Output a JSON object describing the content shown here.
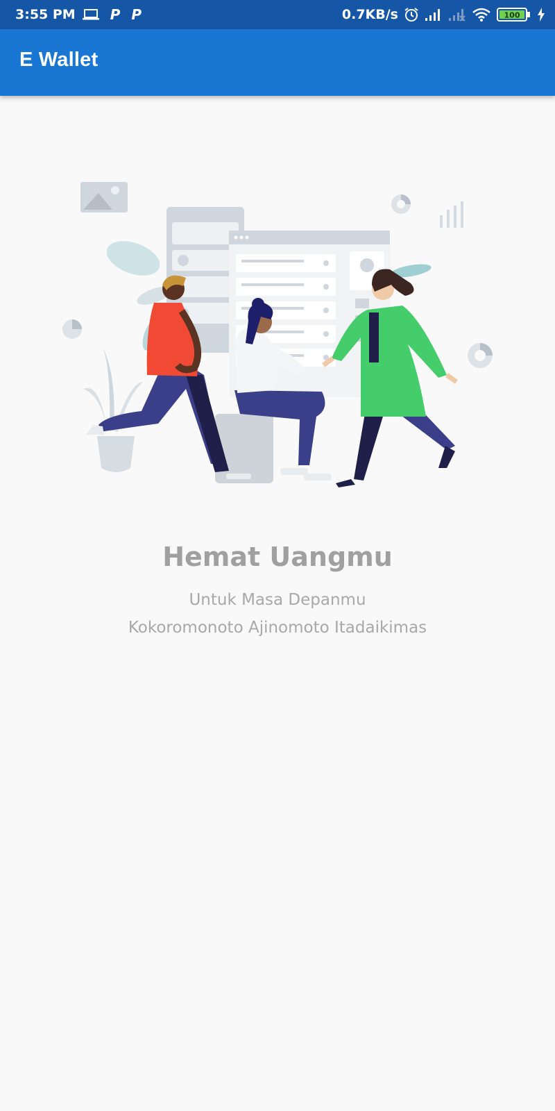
{
  "status_bar": {
    "time": "3:55 PM",
    "net_speed": "0.7KB/s",
    "battery": "100",
    "icons": [
      "laptop-icon",
      "parking-p-icon",
      "parking-p-icon",
      "alarm-icon",
      "signal-icon",
      "signal-no-service-icon",
      "wifi-icon",
      "battery-icon",
      "charging-bolt-icon"
    ]
  },
  "app_bar": {
    "title": "E Wallet"
  },
  "onboarding": {
    "illustration": "people-collaborating-illustration",
    "headline": "Hemat Uangmu",
    "subtitle_line1": "Untuk Masa Depanmu",
    "subtitle_line2": "Kokoromonoto Ajinomoto Itadaikimas"
  },
  "colors": {
    "status_bar": "#1656a6",
    "app_bar": "#1976d2",
    "background": "#f9f9f9",
    "headline_text": "#a0a0a0",
    "subtitle_text": "#a8a8a8"
  }
}
